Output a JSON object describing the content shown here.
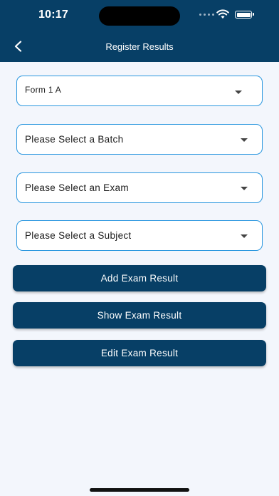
{
  "status_bar": {
    "time": "10:17"
  },
  "header": {
    "title": "Register Results",
    "back_icon": "chevron-left-icon"
  },
  "form": {
    "class_select": {
      "value": "Form 1 A"
    },
    "batch_select": {
      "value": "Please Select a Batch"
    },
    "exam_select": {
      "value": "Please Select an Exam"
    },
    "subject_select": {
      "value": "Please Select a Subject"
    }
  },
  "actions": {
    "add": "Add Exam Result",
    "show": "Show Exam Result",
    "edit": "Edit Exam Result"
  },
  "colors": {
    "primary": "#073f66",
    "border": "#2a97df",
    "background": "#f3f6fc"
  }
}
